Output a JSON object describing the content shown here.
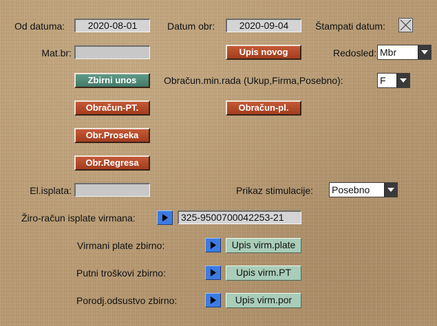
{
  "form": {
    "od_datuma_label": "Od datuma:",
    "od_datuma_value": "2020-08-01",
    "datum_obr_label": "Datum obr:",
    "datum_obr_value": "2020-09-04",
    "stampati_datum_label": "Štampati datum:",
    "stampati_datum_checked": true,
    "mat_br_label": "Mat.br:",
    "mat_br_value": "",
    "upis_novog_label": "Upis novog",
    "redosled_label": "Redosled:",
    "redosled_value": "Mbr",
    "zbirni_unos_label": "Zbirni unos",
    "obracun_min_rada_label": "Obračun.min.rada (Ukup,Firma,Posebno):",
    "obracun_min_rada_value": "F",
    "obracun_pt_label": "Obračun-PT.",
    "obracun_pl_label": "Obračun-pl.",
    "obr_proseka_label": "Obr.Proseka",
    "obr_regresa_label": "Obr.Regresa",
    "el_isplata_label": "El.isplata:",
    "el_isplata_value": "",
    "prikaz_stimulacije_label": "Prikaz stimulacije:",
    "prikaz_stimulacije_value": "Posebno",
    "ziro_racun_label": "Žiro-račun isplate virmana:",
    "ziro_racun_value": "325-9500700042253-21",
    "virmani_plate_label": "Virmani plate zbirno:",
    "upis_virm_plate_label": "Upis virm.plate",
    "putni_troskovi_label": "Putni troškovi zbirno:",
    "upis_virm_pt_label": "Upis virm.PT",
    "porodj_odsustvo_label": "Porodj.odsustvo zbirno:",
    "upis_virm_por_label": "Upis virm.por"
  },
  "icons": {
    "arrow": "play-right-icon",
    "dropdown": "chevron-down-icon",
    "checkbox": "checkbox-x-icon"
  },
  "colors": {
    "red_button": "#b04828",
    "green_button": "#52897a",
    "light_button": "#a9cdb8",
    "blue_arrow": "#3d7be3"
  }
}
